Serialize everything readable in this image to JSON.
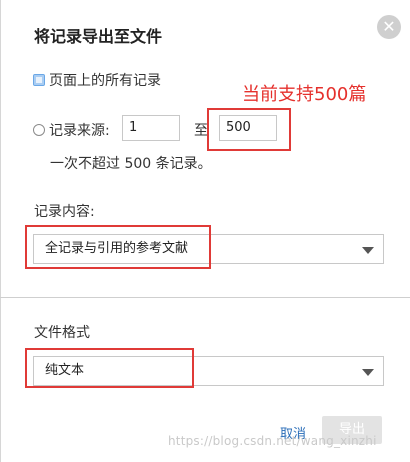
{
  "dialog": {
    "title": "将记录导出至文件",
    "close_icon": "close-icon"
  },
  "annotation": {
    "text": "当前支持500篇",
    "color": "#e5302c"
  },
  "record_range": {
    "all_option_label": "页面上的所有记录",
    "source_option_label": "记录来源:",
    "from_value": "1",
    "to_label": "至",
    "to_value": "500",
    "note": "一次不超过 500 条记录。"
  },
  "record_content": {
    "label": "记录内容:",
    "selected": "全记录与引用的参考文献"
  },
  "file_format": {
    "label": "文件格式",
    "selected": "纯文本"
  },
  "actions": {
    "cancel_label": "取消",
    "export_label": "导出"
  },
  "watermark": "https://blog.csdn.net/wang_xinzhi",
  "colors": {
    "highlight_red": "#e03a37",
    "link_blue": "#2a6db8"
  }
}
